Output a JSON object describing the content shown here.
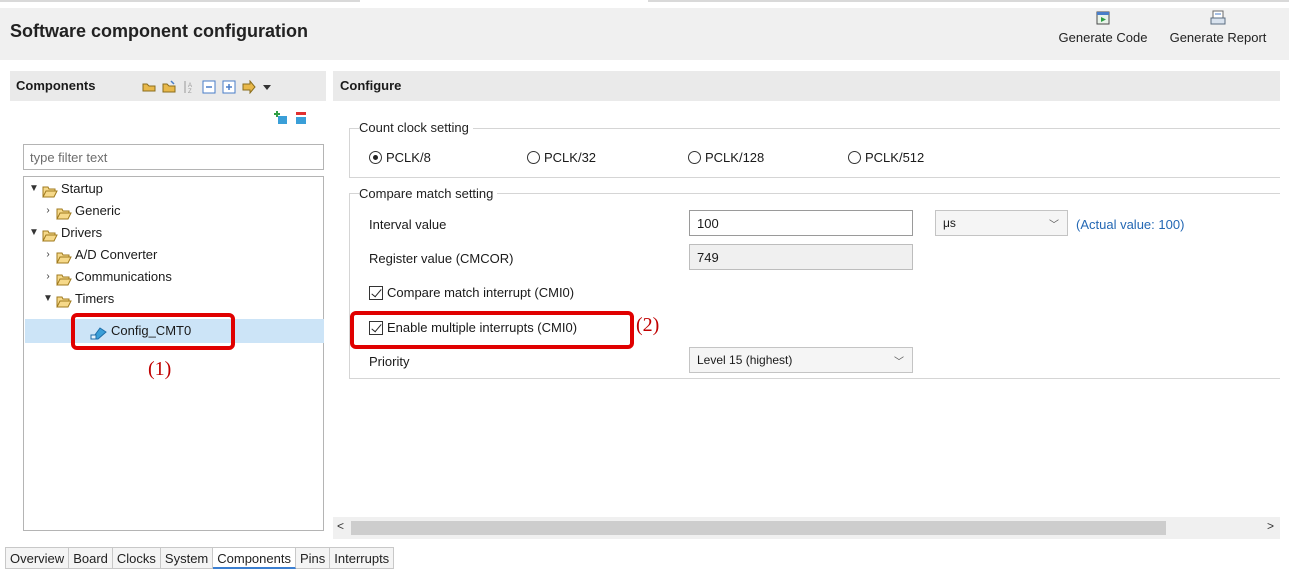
{
  "header": {
    "title": "Software component configuration",
    "buttons": [
      {
        "label": "Generate Code",
        "icon": "generate-code-icon"
      },
      {
        "label": "Generate Report",
        "icon": "generate-report-icon"
      }
    ]
  },
  "left_panel": {
    "title": "Components",
    "filter_placeholder": "type filter text",
    "tree": [
      {
        "label": "Startup"
      },
      {
        "label": "Generic"
      },
      {
        "label": "Drivers"
      },
      {
        "label": "A/D Converter"
      },
      {
        "label": "Communications"
      },
      {
        "label": "Timers"
      },
      {
        "label": "Config_CMT0"
      }
    ]
  },
  "right_panel": {
    "title": "Configure",
    "count_clock": {
      "label": "Count clock setting",
      "options": [
        "PCLK/8",
        "PCLK/32",
        "PCLK/128",
        "PCLK/512"
      ],
      "selected": "PCLK/8"
    },
    "compare_match": {
      "label": "Compare match setting",
      "interval_label": "Interval value",
      "interval_value": "100",
      "unit": "μs",
      "actual_value": "(Actual value: 100)",
      "register_label": "Register value (CMCOR)",
      "register_value": "749",
      "cmi_label": "Compare match interrupt (CMI0)",
      "multi_label": "Enable multiple interrupts (CMI0)",
      "priority_label": "Priority",
      "priority_value": "Level 15 (highest)"
    }
  },
  "annotations": {
    "callout1": "(1)",
    "callout2": "(2)"
  },
  "tabs": [
    "Overview",
    "Board",
    "Clocks",
    "System",
    "Components",
    "Pins",
    "Interrupts"
  ],
  "active_tab": "Components",
  "colors": {
    "highlight": "#e00000",
    "selection": "#cce4f7",
    "link": "#2468b4",
    "folder": "#e8b84a"
  }
}
